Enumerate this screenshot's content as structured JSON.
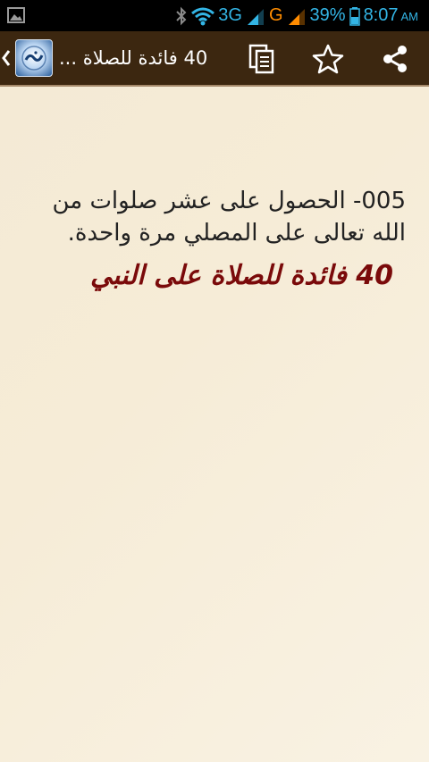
{
  "status_bar": {
    "network_3g": "3G",
    "network_g": "G",
    "battery": "39%",
    "time": "8:07",
    "ampm": "AM",
    "icons": [
      "image-icon",
      "bluetooth-icon",
      "wifi-icon",
      "signal-icon",
      "signal-icon"
    ]
  },
  "action_bar": {
    "title": "40 فائدة للصلاة ...",
    "icons": [
      "chevron-left-icon",
      "app-logo",
      "copy-icon",
      "star-icon",
      "share-icon"
    ]
  },
  "content": {
    "body_text": "005- الحصول على عشر صلوات من الله تعالى على المصلي مرة واحدة.",
    "heading": "40 فائدة للصلاة على النبي"
  },
  "colors": {
    "status_bar_bg": "#000000",
    "status_accent": "#33b5e5",
    "action_bar_bg": "#3c2710",
    "content_bg": "#f6edd8",
    "heading_color": "#7a0a0a"
  }
}
